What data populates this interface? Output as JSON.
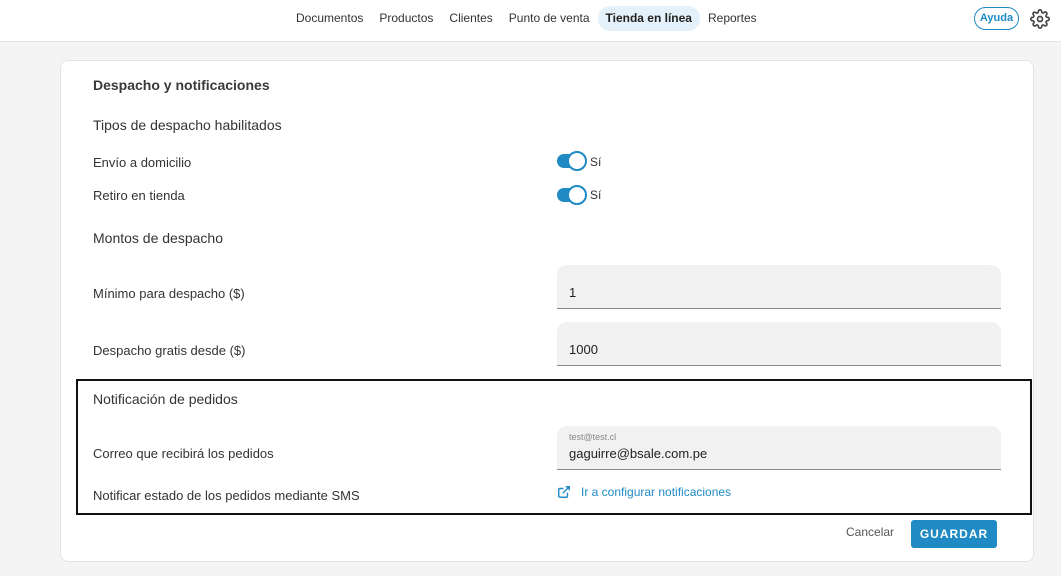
{
  "nav": {
    "items": [
      "Documentos",
      "Productos",
      "Clientes",
      "Punto de venta",
      "Tienda en línea",
      "Reportes"
    ],
    "active_index": 4,
    "help_label": "Ayuda",
    "settings_icon": "gear-icon"
  },
  "card": {
    "title": "Despacho y notificaciones",
    "shipping_types": {
      "heading": "Tipos de despacho habilitados",
      "home_delivery": {
        "label": "Envío a domicilio",
        "state_text": "Sí",
        "enabled": true
      },
      "store_pickup": {
        "label": "Retiro en tienda",
        "state_text": "Sí",
        "enabled": true
      }
    },
    "shipping_amounts": {
      "heading": "Montos de despacho",
      "minimum": {
        "label": "Mínimo para despacho ($)",
        "value": "1"
      },
      "free_from": {
        "label": "Despacho gratis desde ($)",
        "value": "1000"
      }
    },
    "order_notifications": {
      "heading": "Notificación de pedidos",
      "email": {
        "label": "Correo que recibirá los pedidos",
        "placeholder": "test@test.cl",
        "value": "gaguirre@bsale.com.pe"
      },
      "sms": {
        "label": "Notificar estado de los pedidos mediante SMS",
        "link_text": "Ir a configurar notificaciones",
        "link_icon": "external-link-icon"
      }
    },
    "actions": {
      "cancel_label": "Cancelar",
      "save_label": "GUARDAR"
    }
  },
  "colors": {
    "accent": "#1f8ac4",
    "active_tab_bg": "#e4f1fa",
    "highlight_border": "#111111"
  }
}
